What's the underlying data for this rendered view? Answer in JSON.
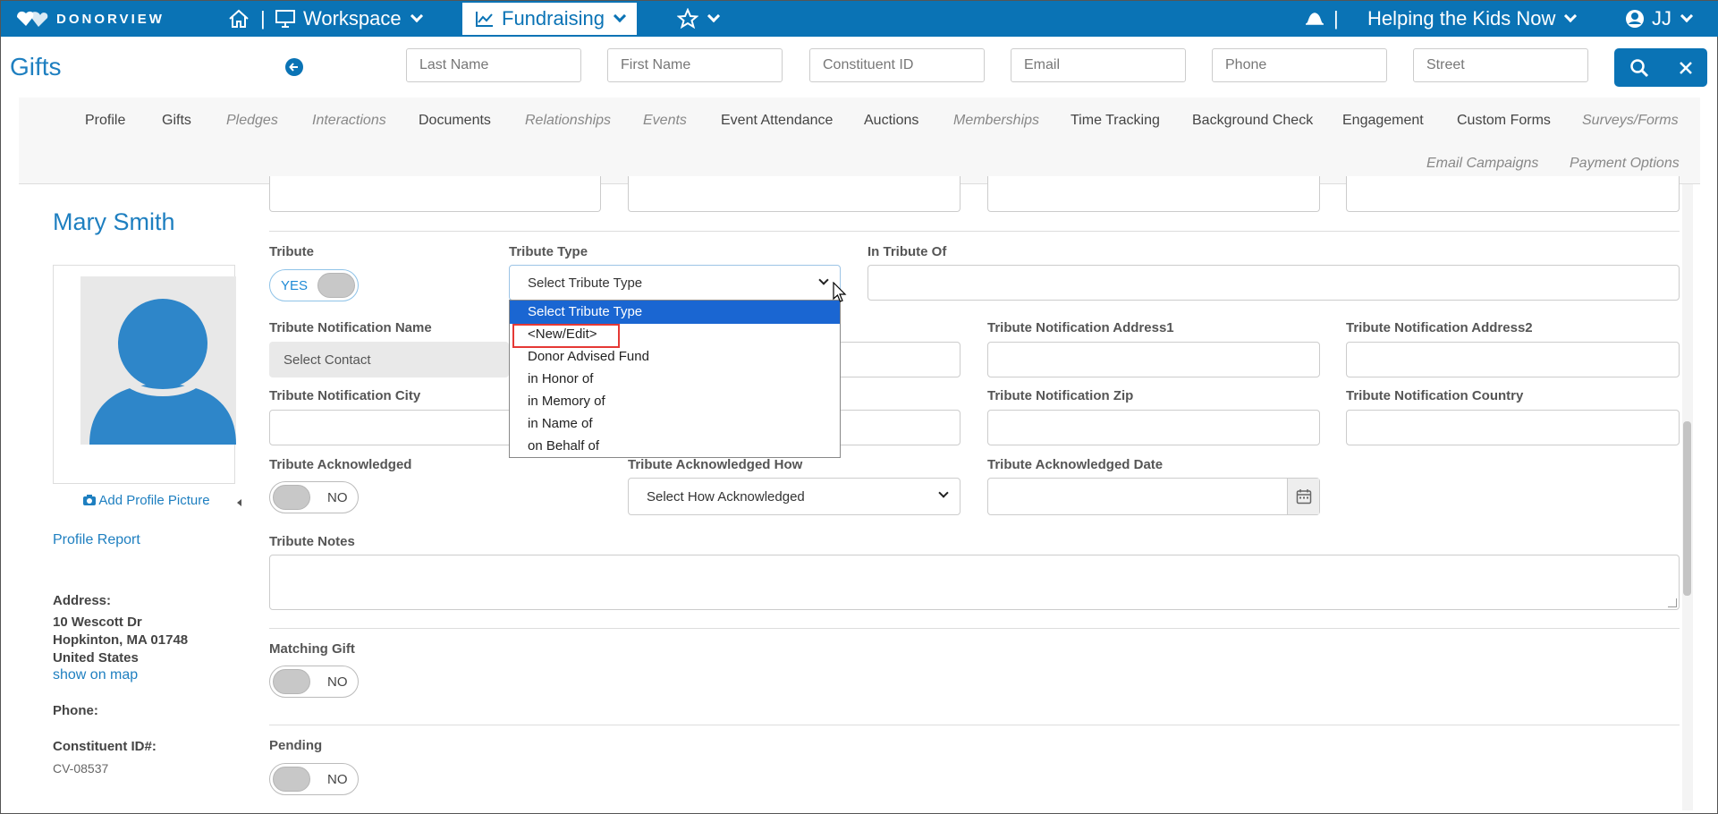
{
  "topbar": {
    "logo_text": "DONORVIEW",
    "separator": "|",
    "workspace": "Workspace",
    "fundraising": "Fundraising",
    "org_name": "Helping the Kids Now",
    "user_initials": "JJ",
    "bg_color": "#0a73b5"
  },
  "header": {
    "page_title": "Gifts"
  },
  "search": {
    "last_name": "Last Name",
    "first_name": "First Name",
    "constituent_id": "Constituent ID",
    "email": "Email",
    "phone": "Phone",
    "street": "Street"
  },
  "tabs": [
    {
      "label": "Profile"
    },
    {
      "label": "Gifts"
    },
    {
      "label": "Pledges"
    },
    {
      "label": "Interactions"
    },
    {
      "label": "Documents"
    },
    {
      "label": "Relationships"
    },
    {
      "label": "Events"
    },
    {
      "label": "Event Attendance"
    },
    {
      "label": "Auctions"
    },
    {
      "label": "Memberships"
    },
    {
      "label": "Time Tracking"
    },
    {
      "label": "Background Check"
    },
    {
      "label": "Engagement"
    },
    {
      "label": "Custom Forms"
    },
    {
      "label": "Surveys/Forms"
    },
    {
      "label": "Email Campaigns"
    },
    {
      "label": "Payment Options"
    }
  ],
  "profile": {
    "name": "Mary Smith",
    "add_picture": "Add Profile Picture",
    "report": "Profile Report",
    "address_label": "Address:",
    "address_line1": "10 Wescott Dr",
    "address_line2": "Hopkinton, MA 01748",
    "address_line3": "United States",
    "map_link": "show on map",
    "phone_label": "Phone:",
    "cid_label": "Constituent ID#:",
    "cid_value": "CV-08537"
  },
  "form": {
    "tribute_label": "Tribute",
    "tribute_toggle": "YES",
    "tribute_type_label": "Tribute Type",
    "tribute_type_value": "Select Tribute Type",
    "in_tribute_of_label": "In Tribute Of",
    "notif_name_label": "Tribute Notification Name",
    "notif_name_placeholder": "Select Contact",
    "notif_addr1_label": "Tribute Notification Address1",
    "notif_addr2_label": "Tribute Notification Address2",
    "notif_city_label": "Tribute Notification City",
    "notif_zip_label": "Tribute Notification Zip",
    "notif_country_label": "Tribute Notification Country",
    "ack_label": "Tribute Acknowledged",
    "ack_toggle": "NO",
    "ack_how_label": "Tribute Acknowledged How",
    "ack_how_value": "Select How Acknowledged",
    "ack_date_label": "Tribute Acknowledged Date",
    "notes_label": "Tribute Notes",
    "matching_label": "Matching Gift",
    "matching_toggle": "NO",
    "pending_label": "Pending",
    "pending_toggle": "NO"
  },
  "dropdown": {
    "options": [
      "Select Tribute Type",
      "<New/Edit>",
      "Donor Advised Fund",
      "in Honor of",
      "in Memory of",
      "in Name of",
      "on Behalf of"
    ],
    "selected_color": "#1a66d2",
    "highlight_color": "#e53935"
  }
}
